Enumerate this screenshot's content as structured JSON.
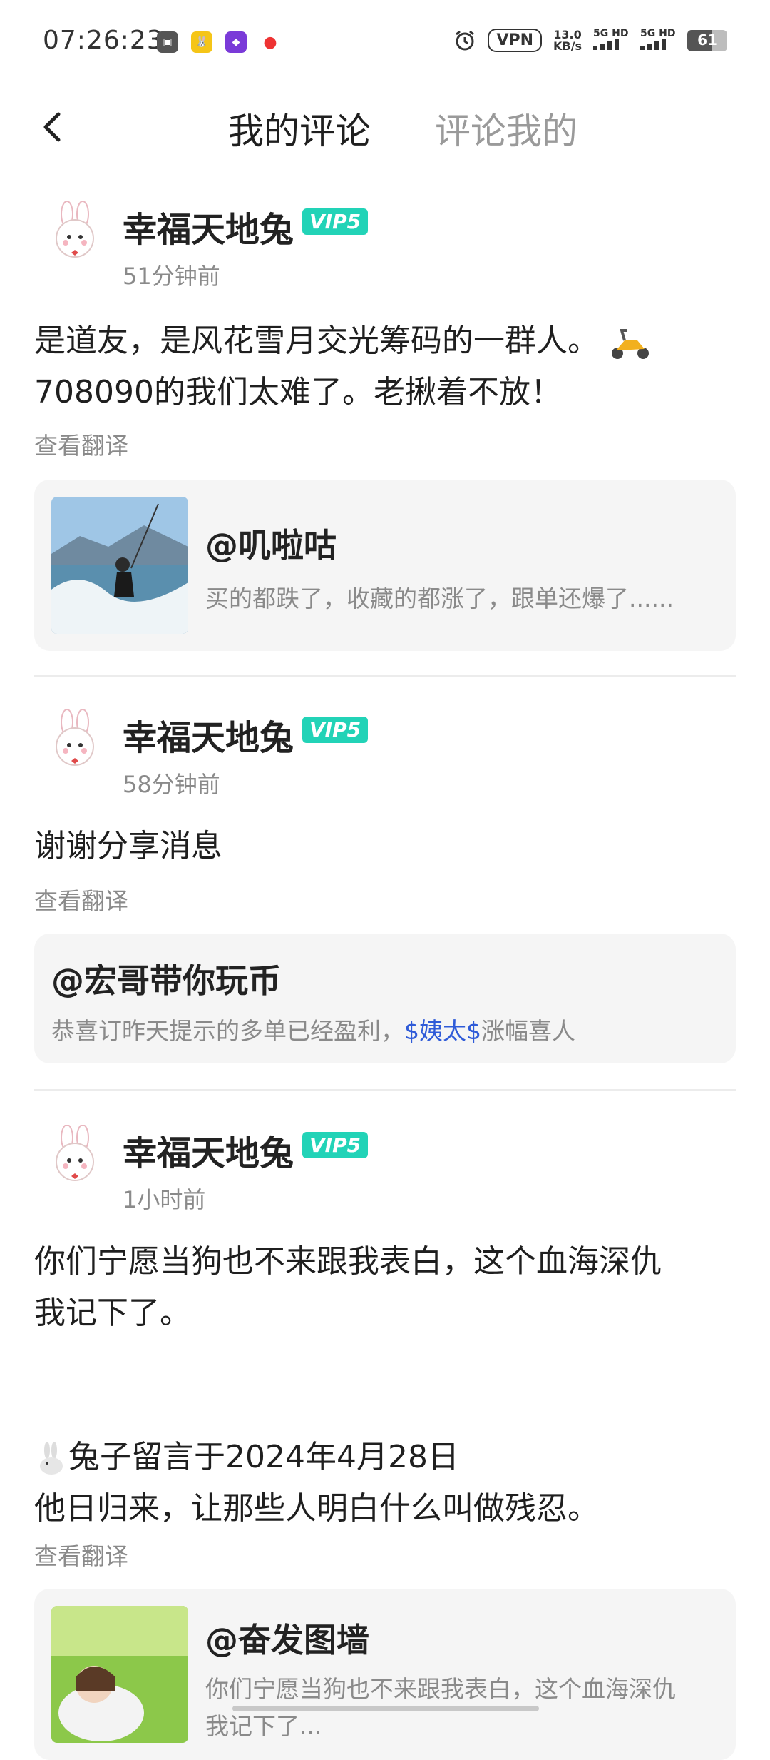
{
  "status_bar": {
    "time": "07:26:23",
    "vpn": "VPN",
    "speed_value": "13.0",
    "speed_unit": "KB/s",
    "signal1": "5G HD",
    "signal2": "5G HD",
    "battery": "61",
    "battery_level": 0.61
  },
  "header": {
    "tab_active": "我的评论",
    "tab_inactive": "评论我的"
  },
  "comments": [
    {
      "user": "幸福天地兔",
      "vip": "VIP5",
      "time": "51分钟前",
      "line1": "是道友，是风花雪月交光筹码的一群人。",
      "line2": "708090的我们太难了。老揪着不放！",
      "translate": "查看翻译",
      "quote_user": "@叽啦咕",
      "quote_text": "买的都跌了，收藏的都涨了，跟单还爆了......"
    },
    {
      "user": "幸福天地兔",
      "vip": "VIP5",
      "time": "58分钟前",
      "line1": "谢谢分享消息",
      "translate": "查看翻译",
      "quote_user": "@宏哥带你玩币",
      "quote_text_before": "恭喜订昨天提示的多单已经盈利，",
      "quote_link": "$姨太$",
      "quote_text_after": "涨幅喜人"
    },
    {
      "user": "幸福天地兔",
      "vip": "VIP5",
      "time": "1小时前",
      "line1": "你们宁愿当狗也不来跟我表白，这个血海深仇",
      "line2": "我记下了。",
      "line3": "兔子留言于2024年4月28日",
      "line4": "他日归来，让那些人明白什么叫做残忍。",
      "translate": "查看翻译",
      "quote_user": "@奋发图墙",
      "quote_text": "你们宁愿当狗也不来跟我表白，这个血海深仇",
      "quote_text2": "我记下了..."
    }
  ]
}
